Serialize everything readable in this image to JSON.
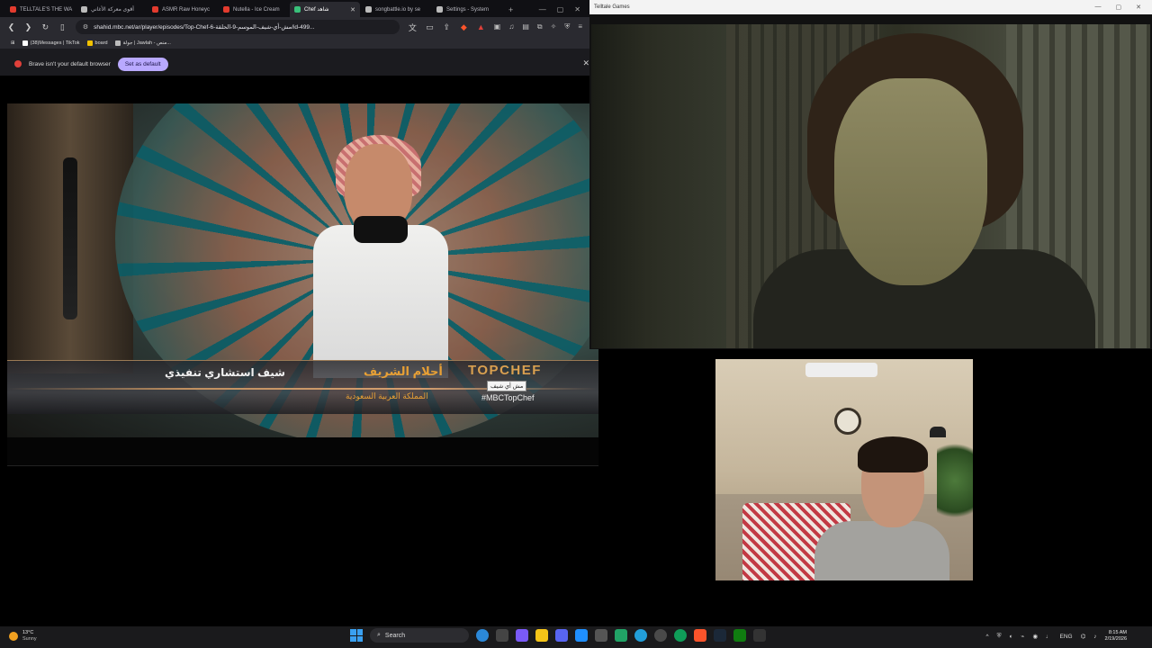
{
  "browser": {
    "tabs": [
      {
        "label": "TELLTALE'S THE WA",
        "fav_color": "#e33b2e"
      },
      {
        "label": "أقوى معركة الأغاني",
        "fav_color": "#bbbbbb"
      },
      {
        "label": "ASMR Raw Honeyc",
        "fav_color": "#e33b2e"
      },
      {
        "label": "Nutella - Ice Cream",
        "fav_color": "#e33b2e"
      },
      {
        "label": "Chef شاهد",
        "fav_color": "#39c07a",
        "active": true
      },
      {
        "label": "songbattle.io by se",
        "fav_color": "#bbbbbb"
      },
      {
        "label": "Settings - System",
        "fav_color": "#bbbbbb"
      }
    ],
    "new_tab": "+",
    "window_controls": [
      "—",
      "▢",
      "✕"
    ],
    "url": "shahid.mbc.net/ar/player/episodes/Top-Chef-6-مش-أي-شيف-الموسم-9-الحلقة/id-499...",
    "bookmarks": [
      {
        "label": "(38)Messages | TikTok",
        "color": "#ffffff"
      },
      {
        "label": "board",
        "color": "#f2c200"
      },
      {
        "label": "جولة | Jawlah - منص...",
        "color": "#bbbbbb"
      }
    ],
    "infobar": {
      "message": "Brave isn't your default browser",
      "button": "Set as default",
      "close": "✕"
    }
  },
  "video": {
    "lower_third": {
      "title": "شيف استشاري تنفيذي",
      "name": "أحلام الشريف",
      "country": "المملكة العربية السعودية",
      "logo": "TOPCHEF",
      "tooltip": "مش أي شيف",
      "hashtag": "#MBCTopChef"
    }
  },
  "game": {
    "title": "Telltale Games",
    "controls": [
      "—",
      "▢",
      "✕"
    ]
  },
  "taskbar": {
    "weather": {
      "temp": "13°C",
      "condition": "Sunny"
    },
    "search_label": "Search",
    "apps": [
      "#2b88d8",
      "#444444",
      "#7a5af8",
      "#f5c518",
      "#5865f2",
      "#1f8fff",
      "#555555",
      "#21a366",
      "#229ed9",
      "#4a4a4a",
      "#fb542b",
      "#1b2838",
      "#107c10",
      "#0f9d58",
      "#333333"
    ],
    "tray": {
      "lang": "ENG",
      "time": "8:15 AM",
      "date": "2/19/2026"
    }
  }
}
